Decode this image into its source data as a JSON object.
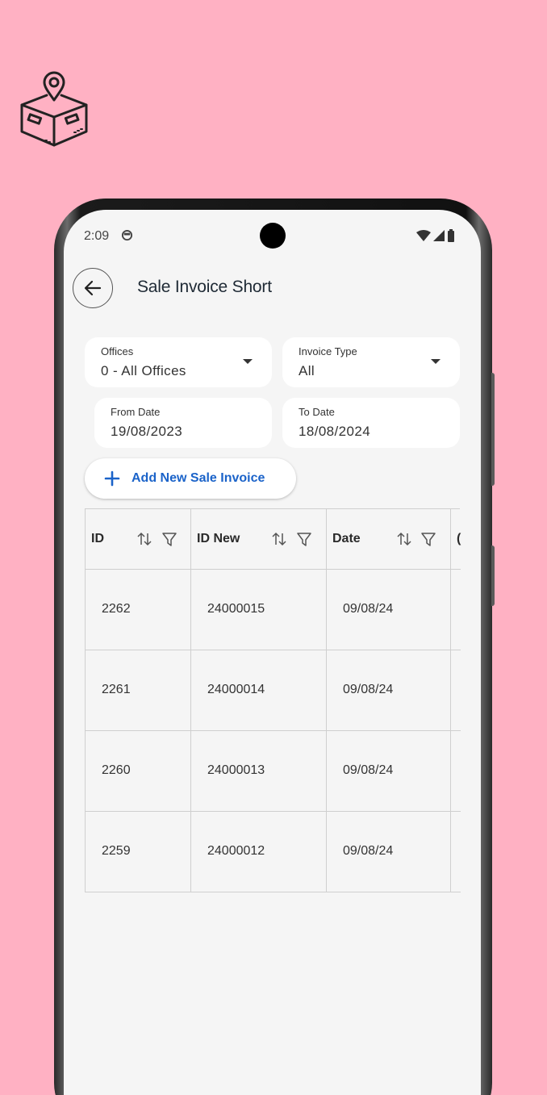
{
  "status_bar": {
    "time": "2:09"
  },
  "app_bar": {
    "title": "Sale Invoice Short"
  },
  "filters": {
    "offices": {
      "label": "Offices",
      "value": "0 - All Offices"
    },
    "invoice_type": {
      "label": "Invoice Type",
      "value": "All"
    },
    "from_date": {
      "label": "From Date",
      "value": "19/08/2023"
    },
    "to_date": {
      "label": "To Date",
      "value": "18/08/2024"
    }
  },
  "add_button": {
    "label": "Add New Sale Invoice"
  },
  "table": {
    "columns": [
      "ID",
      "ID New",
      "Date"
    ],
    "rows": [
      [
        "2262",
        "24000015",
        "09/08/24"
      ],
      [
        "2261",
        "24000014",
        "09/08/24"
      ],
      [
        "2260",
        "24000013",
        "09/08/24"
      ],
      [
        "2259",
        "24000012",
        "09/08/24"
      ]
    ]
  },
  "colors": {
    "background": "#ffb1c3",
    "accent": "#1b63c9",
    "screen": "#f5f5f5"
  }
}
